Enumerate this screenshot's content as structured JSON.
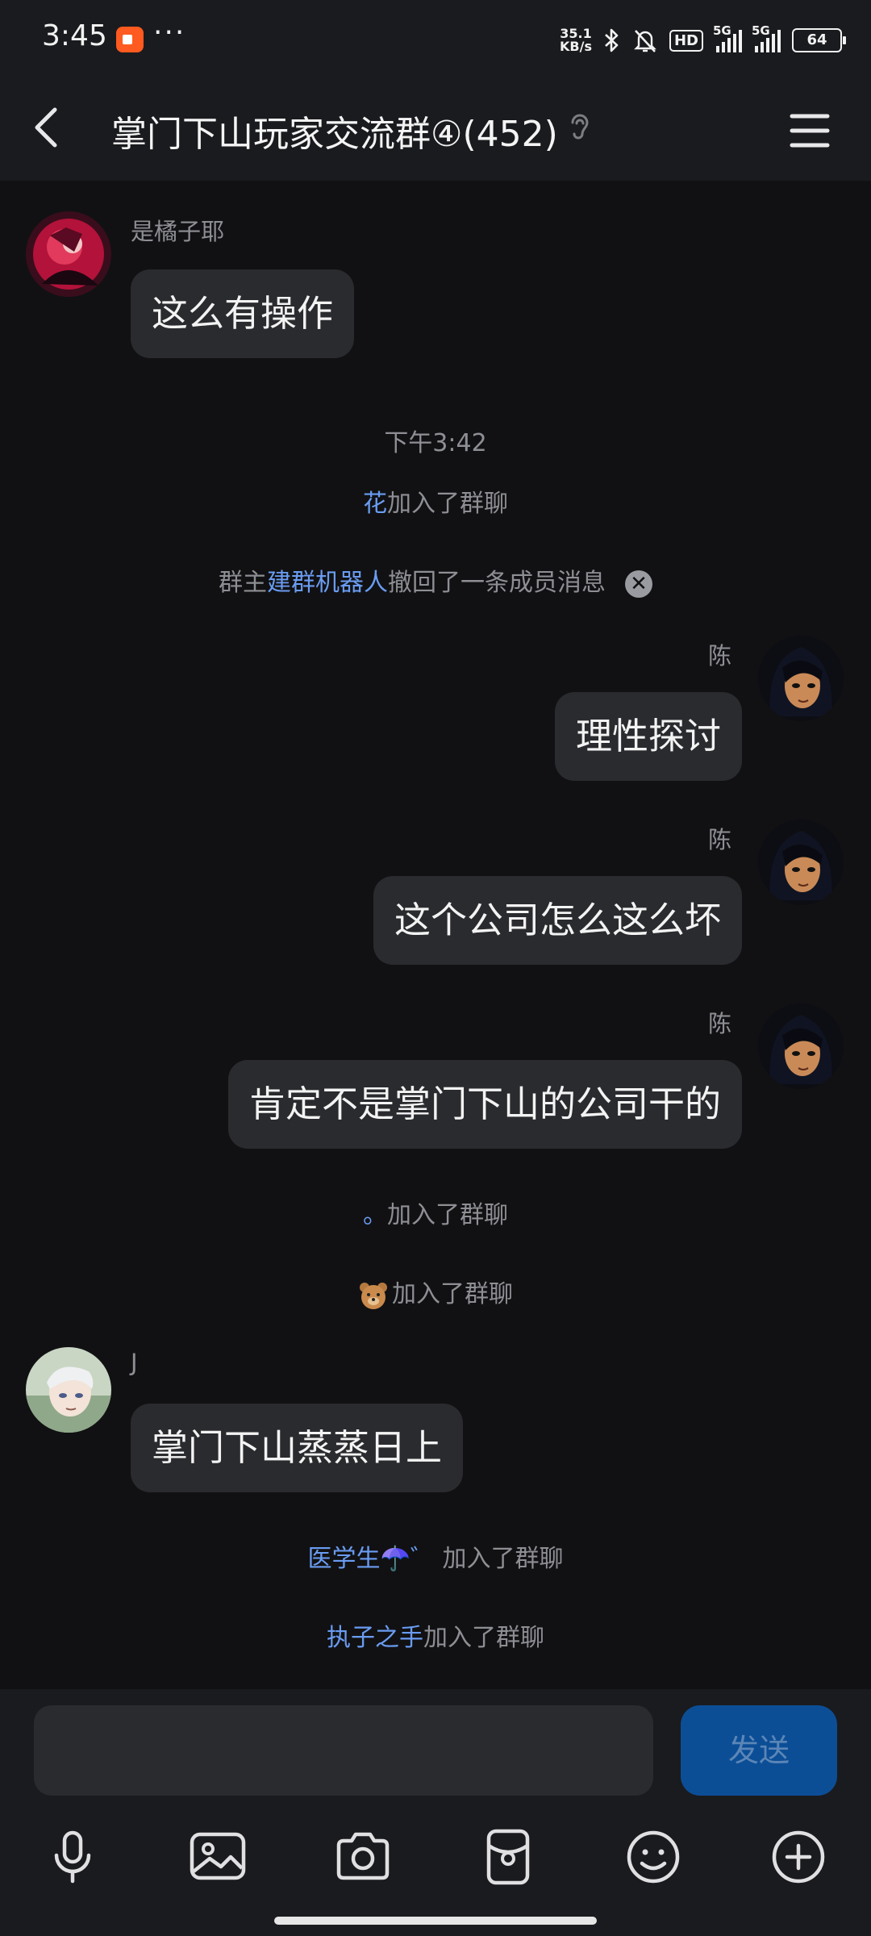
{
  "status_bar": {
    "time": "3:45",
    "more": "···",
    "net_speed_value": "35.1",
    "net_speed_unit": "KB/s",
    "hd_label": "HD",
    "signal1_label": "5G",
    "signal2_label": "5G",
    "battery": "64"
  },
  "header": {
    "title": "掌门下山玩家交流群④(452)"
  },
  "messages": {
    "m1": {
      "sender": "是橘子耶",
      "text": "这么有操作"
    },
    "time_divider": "下午3:42",
    "sys1": {
      "name": "花",
      "action": "加入了群聊"
    },
    "sys2": {
      "prefix": "群主",
      "name": "建群机器人",
      "action": "撤回了一条成员消息",
      "close_glyph": "✕"
    },
    "m2": {
      "sender": "陈",
      "text": "理性探讨"
    },
    "m3": {
      "sender": "陈",
      "text": "这个公司怎么这么坏"
    },
    "m4": {
      "sender": "陈",
      "text": "肯定不是掌门下山的公司干的"
    },
    "sys3": {
      "name": "。",
      "action": "加入了群聊"
    },
    "sys4": {
      "action": "加入了群聊",
      "emoji_icon": "bear-face"
    },
    "m5": {
      "sender": "J",
      "text": "掌门下山蒸蒸日上"
    },
    "sys5": {
      "name": "医学生☂️゛",
      "action": "加入了群聊"
    },
    "sys6": {
      "name": "执子之手",
      "action": "加入了群聊"
    }
  },
  "input": {
    "value": "",
    "send_label": "发送"
  },
  "colors": {
    "background": "#111113",
    "bar": "#1a1b1e",
    "bubble": "#2a2b2e",
    "highlight_name": "#6a9cf2",
    "send_button": "#0c4e96"
  }
}
